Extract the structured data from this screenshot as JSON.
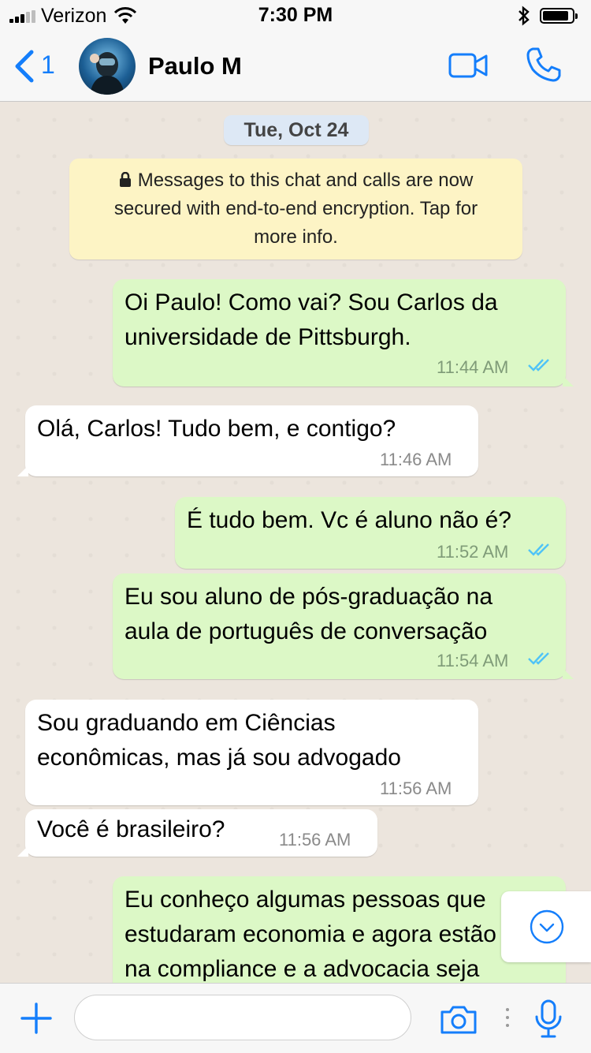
{
  "status_bar": {
    "carrier": "Verizon",
    "time": "7:30 PM"
  },
  "header": {
    "back_count": "1",
    "contact_name": "Paulo M"
  },
  "chat": {
    "date_label": "Tue, Oct 24",
    "encryption_notice": {
      "line1": "Messages to this chat and calls are now",
      "line2": "secured with end-to-end encryption. Tap for",
      "line3": "more info."
    },
    "messages": [
      {
        "direction": "out",
        "text": "Oi Paulo! Como vai? Sou Carlos da\nuniversidade de Pittsburgh.",
        "time": "11:44 AM",
        "status": "read"
      },
      {
        "direction": "in",
        "text": "Olá, Carlos! Tudo bem, e contigo?",
        "time": "11:46 AM"
      },
      {
        "direction": "out",
        "text": "É tudo bem. Vc é aluno não é?",
        "time": "11:52 AM",
        "status": "read"
      },
      {
        "direction": "out",
        "text": "Eu sou aluno de pós-graduação na\naula de português de conversação",
        "time": "11:54 AM",
        "status": "read"
      },
      {
        "direction": "in",
        "text": "Sou graduando em Ciências\neconômicas, mas já sou advogado",
        "time": "11:56 AM"
      },
      {
        "direction": "in",
        "text": "Você é brasileiro?",
        "time": "11:56 AM"
      },
      {
        "direction": "out",
        "text": "Eu conheço algumas pessoas que\nestudaram economia e agora estão\nna compliance e a advocacia seja"
      }
    ]
  },
  "input": {
    "value": ""
  },
  "colors": {
    "accent": "#147efb",
    "outgoing_bubble": "#dcf8c6",
    "incoming_bubble": "#ffffff",
    "encryption_bg": "#fdf4c5",
    "read_ticks": "#4fc3f7"
  }
}
